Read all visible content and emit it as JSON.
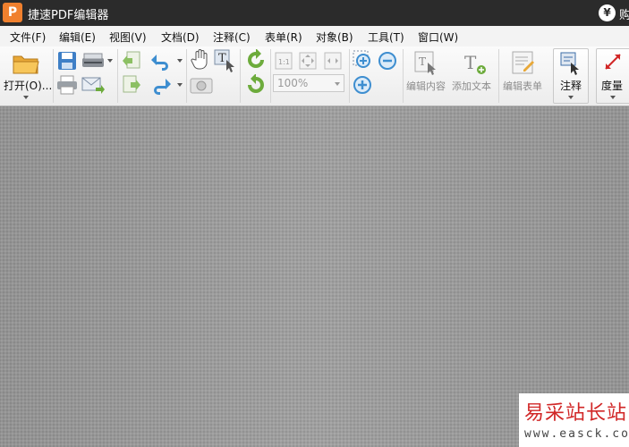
{
  "titlebar": {
    "logo": "P",
    "title": "捷速PDF编辑器",
    "buy_icon": "¥",
    "buy_text": "购"
  },
  "menu": [
    "文件(F)",
    "编辑(E)",
    "视图(V)",
    "文档(D)",
    "注释(C)",
    "表单(R)",
    "对象(B)",
    "工具(T)",
    "窗口(W)"
  ],
  "toolbar": {
    "open_label": "打开(O)...",
    "zoom_value": "100%",
    "edit_content": "编辑内容",
    "add_text": "添加文本",
    "edit_form": "编辑表单",
    "annotate": "注释",
    "measure": "度量"
  },
  "icons": {
    "fit_page": "1:1",
    "add_text_glyph": "T"
  },
  "colors": {
    "accent": "#f0802e",
    "titlebar": "#2b2b2b",
    "icon_blue": "#3e8ed0",
    "icon_green": "#6dab3c",
    "watermark_red": "#d12727"
  },
  "watermark": {
    "title": "易采站长站",
    "url": "www.easck.com"
  }
}
